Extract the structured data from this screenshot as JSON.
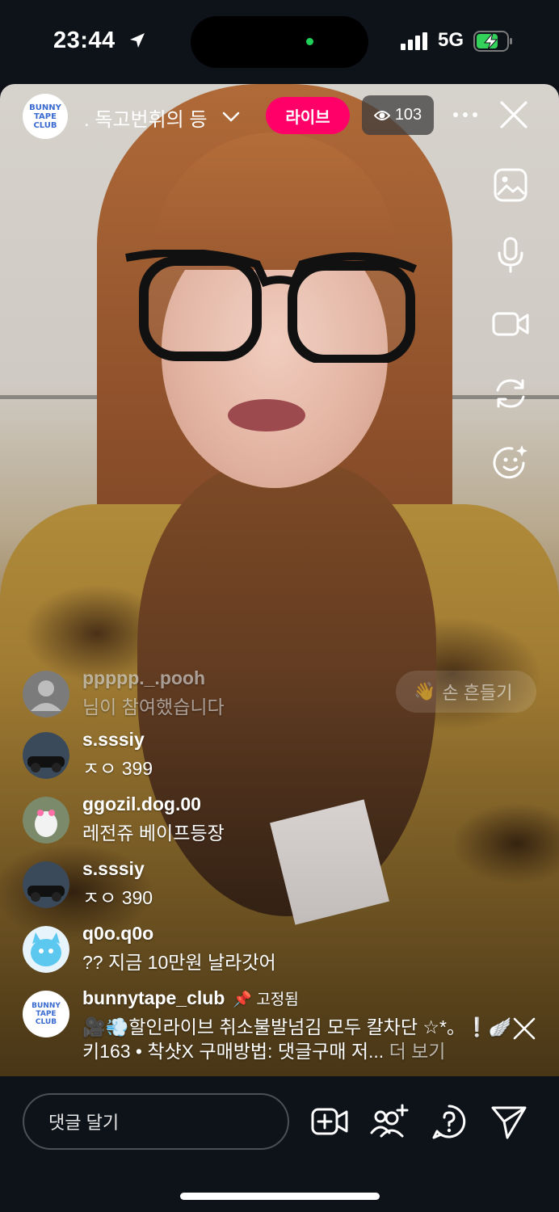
{
  "status_bar": {
    "time": "23:44",
    "network": "5G"
  },
  "live": {
    "host_name": ". 독고번휘의 등",
    "live_label": "라이브",
    "viewer_count": "103",
    "wave_label": "손 흔들기",
    "host_logo_lines": [
      "BUNNY",
      "TAPE",
      "CLUB"
    ]
  },
  "comments": [
    {
      "user": "ppppp._.pooh",
      "text": "님이 참여했습니다",
      "avatar": "default-avatar",
      "faded": true
    },
    {
      "user": "s.sssiy",
      "text": "ㅈㅇ 399",
      "avatar": "car-photo"
    },
    {
      "user": "ggozil.dog.00",
      "text": "레전쥬 베이프등장",
      "avatar": "dog-photo"
    },
    {
      "user": "s.sssiy",
      "text": "ㅈㅇ 390",
      "avatar": "car-photo"
    },
    {
      "user": "q0o.q0o",
      "text": "?? 지금 10만원 날라갓어",
      "avatar": "blue-character"
    },
    {
      "user": "bunnytape_club",
      "pinned_label": "고정됨",
      "text": "🎥💨할인라이브 취소불발넘김 모두 칼차단 ☆*。❕🪽",
      "text2": "키163 • 착샷X 구매방법: 댓글구매 저...",
      "see_more": "더 보기",
      "avatar": "club-logo"
    }
  ],
  "bottom_bar": {
    "comment_placeholder": "댓글 달기"
  },
  "colors": {
    "live_pink": "#ff0069",
    "bar_bg": "#0e131a"
  }
}
